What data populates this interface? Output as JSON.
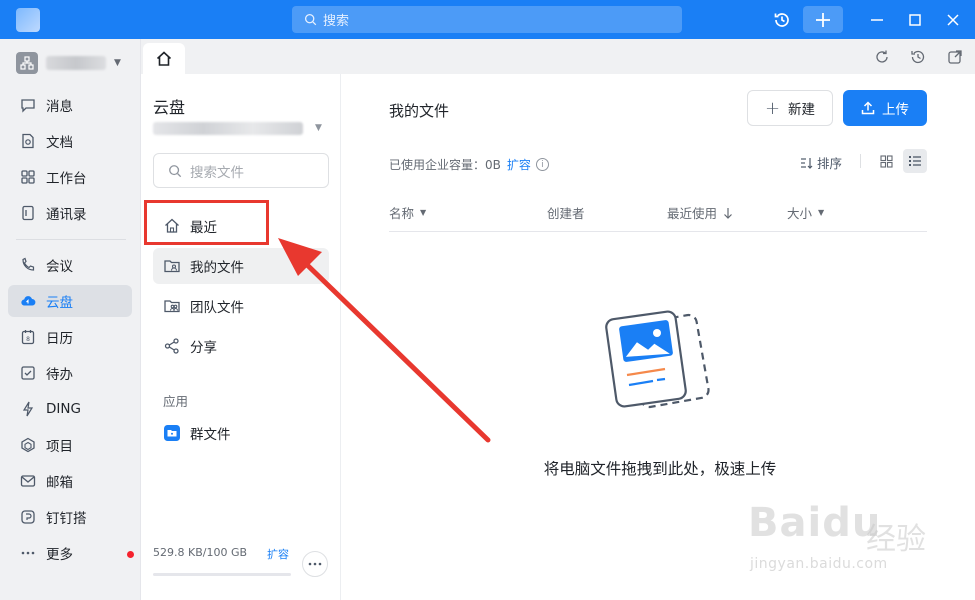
{
  "titlebar": {
    "search_placeholder": "搜索"
  },
  "leftnav": {
    "items": [
      {
        "label": "消息",
        "icon": "message-icon"
      },
      {
        "label": "文档",
        "icon": "document-icon"
      },
      {
        "label": "工作台",
        "icon": "workbench-icon"
      },
      {
        "label": "通讯录",
        "icon": "contacts-icon"
      },
      {
        "label": "会议",
        "icon": "meeting-icon"
      },
      {
        "label": "云盘",
        "icon": "cloud-drive-icon",
        "active": true
      },
      {
        "label": "日历",
        "icon": "calendar-icon"
      },
      {
        "label": "待办",
        "icon": "todo-icon"
      },
      {
        "label": "DING",
        "icon": "ding-icon"
      },
      {
        "label": "项目",
        "icon": "project-icon"
      },
      {
        "label": "邮箱",
        "icon": "mail-icon"
      },
      {
        "label": "钉钉搭",
        "icon": "dingda-icon"
      },
      {
        "label": "更多",
        "icon": "more-icon"
      }
    ]
  },
  "midpanel": {
    "title": "云盘",
    "search_placeholder": "搜索文件",
    "items": [
      {
        "label": "最近",
        "icon": "home-icon"
      },
      {
        "label": "我的文件",
        "icon": "my-folder-icon",
        "active": true
      },
      {
        "label": "团队文件",
        "icon": "team-folder-icon"
      },
      {
        "label": "分享",
        "icon": "share-icon"
      }
    ],
    "section_label": "应用",
    "app_items": [
      {
        "label": "群文件",
        "icon": "group-file-icon"
      }
    ],
    "storage": "529.8 KB/100 GB",
    "storage_expand": "扩容",
    "storage_used_fraction": 0.0
  },
  "main": {
    "title": "我的文件",
    "new_button": "新建",
    "upload_button": "上传",
    "usage_text": "已使用企业容量：0B",
    "usage_expand": "扩容",
    "sort_label": "排序",
    "columns": [
      "名称",
      "创建者",
      "最近使用",
      "大小"
    ],
    "empty_text": "将电脑文件拖拽到此处，极速上传"
  },
  "watermark": {
    "brand": "Baidu",
    "brand_cn": "经验",
    "url": "jingyan.baidu.com"
  },
  "colors": {
    "accent": "#1a7ff5",
    "annotation": "#e8382f"
  }
}
